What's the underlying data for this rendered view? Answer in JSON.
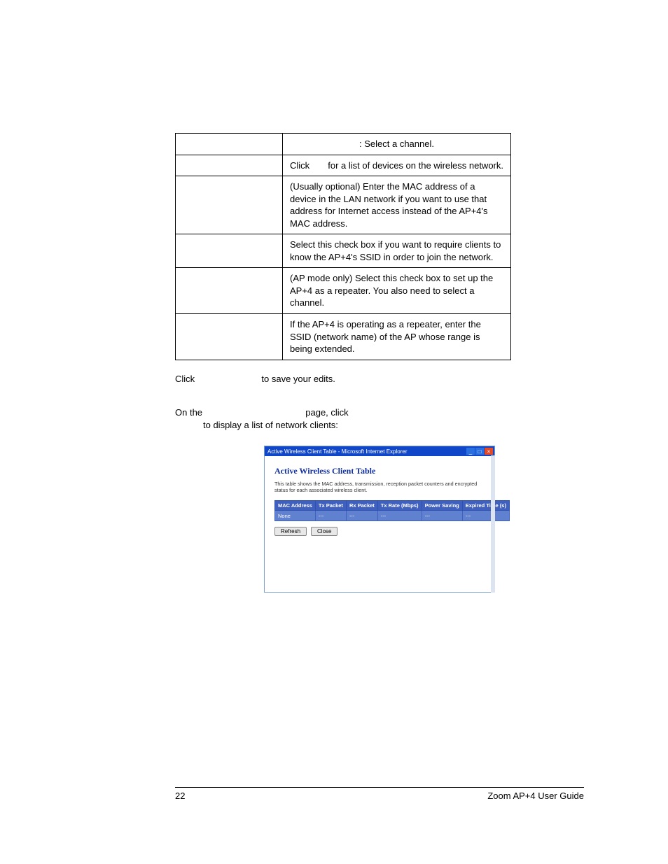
{
  "table": {
    "rows": [
      {
        "left": "",
        "right_a": "",
        "right_b": ": Select a channel."
      },
      {
        "left": "",
        "right_a": "Click ",
        "right_b": " for a list of devices on the wireless network."
      },
      {
        "left": "",
        "right_a": "(Usually optional) Enter the MAC address of a device in the LAN network if you want to use that address for Internet access instead of the AP+4's MAC address.",
        "right_b": ""
      },
      {
        "left": "",
        "right_a": "Select this check box if you want to require clients to know the AP+4's SSID in order to join the network.",
        "right_b": ""
      },
      {
        "left": "",
        "right_a": "(AP mode only) Select this check box to set up the AP+4 as a repeater. You also need to select a channel.",
        "right_b": ""
      },
      {
        "left": "",
        "right_a": "If the AP+4 is operating as a repeater, enter the SSID (network name) of the AP whose range is being extended.",
        "right_b": ""
      }
    ]
  },
  "para_save_a": "Click ",
  "para_save_b": " to save your edits.",
  "on_the_a": "On the ",
  "on_the_b": " page, click ",
  "on_the_c": "to display a list of network clients:",
  "screenshot": {
    "titlebar": "Active Wireless Client Table - Microsoft Internet Explorer",
    "heading": "Active Wireless Client Table",
    "desc": "This table shows the MAC address, transmission, reception packet counters and encrypted status for each associated wireless client.",
    "cols": [
      "MAC Address",
      "Tx Packet",
      "Rx Packet",
      "Tx Rate (Mbps)",
      "Power Saving",
      "Expired Time (s)"
    ],
    "none": "None",
    "dash": "---",
    "refresh": "Refresh",
    "close": "Close"
  },
  "footer": {
    "page": "22",
    "doc": "Zoom AP+4 User Guide"
  }
}
